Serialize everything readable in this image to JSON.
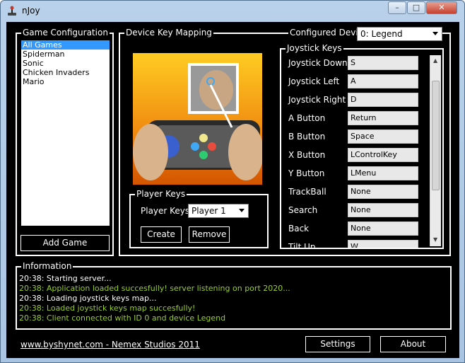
{
  "window": {
    "title": "nJoy"
  },
  "title_buttons": {
    "minimize": "–",
    "maximize": "□",
    "close": "✕"
  },
  "game_config": {
    "legend": "Game Configuration",
    "games": [
      "All Games",
      "Spiderman",
      "Sonic",
      "Chicken Invaders",
      "Mario"
    ],
    "selected_index": 0,
    "add_label": "Add Game"
  },
  "device_mapping": {
    "legend": "Device Key Mapping",
    "configured_label": "Configured Device:",
    "configured_value": "0: Legend"
  },
  "player_keys": {
    "legend": "Player Keys",
    "label": "Player Keys:",
    "value": "Player 1",
    "create_label": "Create",
    "remove_label": "Remove"
  },
  "joystick_keys": {
    "legend": "Joystick Keys",
    "rows": [
      {
        "label": "Joystick Down",
        "value": "S"
      },
      {
        "label": "Joystick Left",
        "value": "A"
      },
      {
        "label": "Joystick Right",
        "value": "D"
      },
      {
        "label": "A Button",
        "value": "Return"
      },
      {
        "label": "B Button",
        "value": "Space"
      },
      {
        "label": "X Button",
        "value": "LControlKey"
      },
      {
        "label": "Y Button",
        "value": "LMenu"
      },
      {
        "label": "TrackBall",
        "value": "None"
      },
      {
        "label": "Search",
        "value": "None"
      },
      {
        "label": "Back",
        "value": "None"
      },
      {
        "label": "Tilt Up",
        "value": "W"
      }
    ]
  },
  "information": {
    "legend": "Information",
    "lines": [
      {
        "text": "20:38: Starting server...",
        "color": "#ffffff"
      },
      {
        "text": "20:38: Application loaded succesfully! server listening on port 2020...",
        "color": "#9acd32"
      },
      {
        "text": "20:38: Loading joystick keys map...",
        "color": "#ffffff"
      },
      {
        "text": "20:38: Loaded joystick keys map succesfully!",
        "color": "#9acd32"
      },
      {
        "text": "20:38: Client connected with ID 0 and device Legend",
        "color": "#9acd32"
      }
    ]
  },
  "footer": {
    "link": "www.byshynet.com - Nemex Studios 2011",
    "settings_label": "Settings",
    "about_label": "About"
  }
}
